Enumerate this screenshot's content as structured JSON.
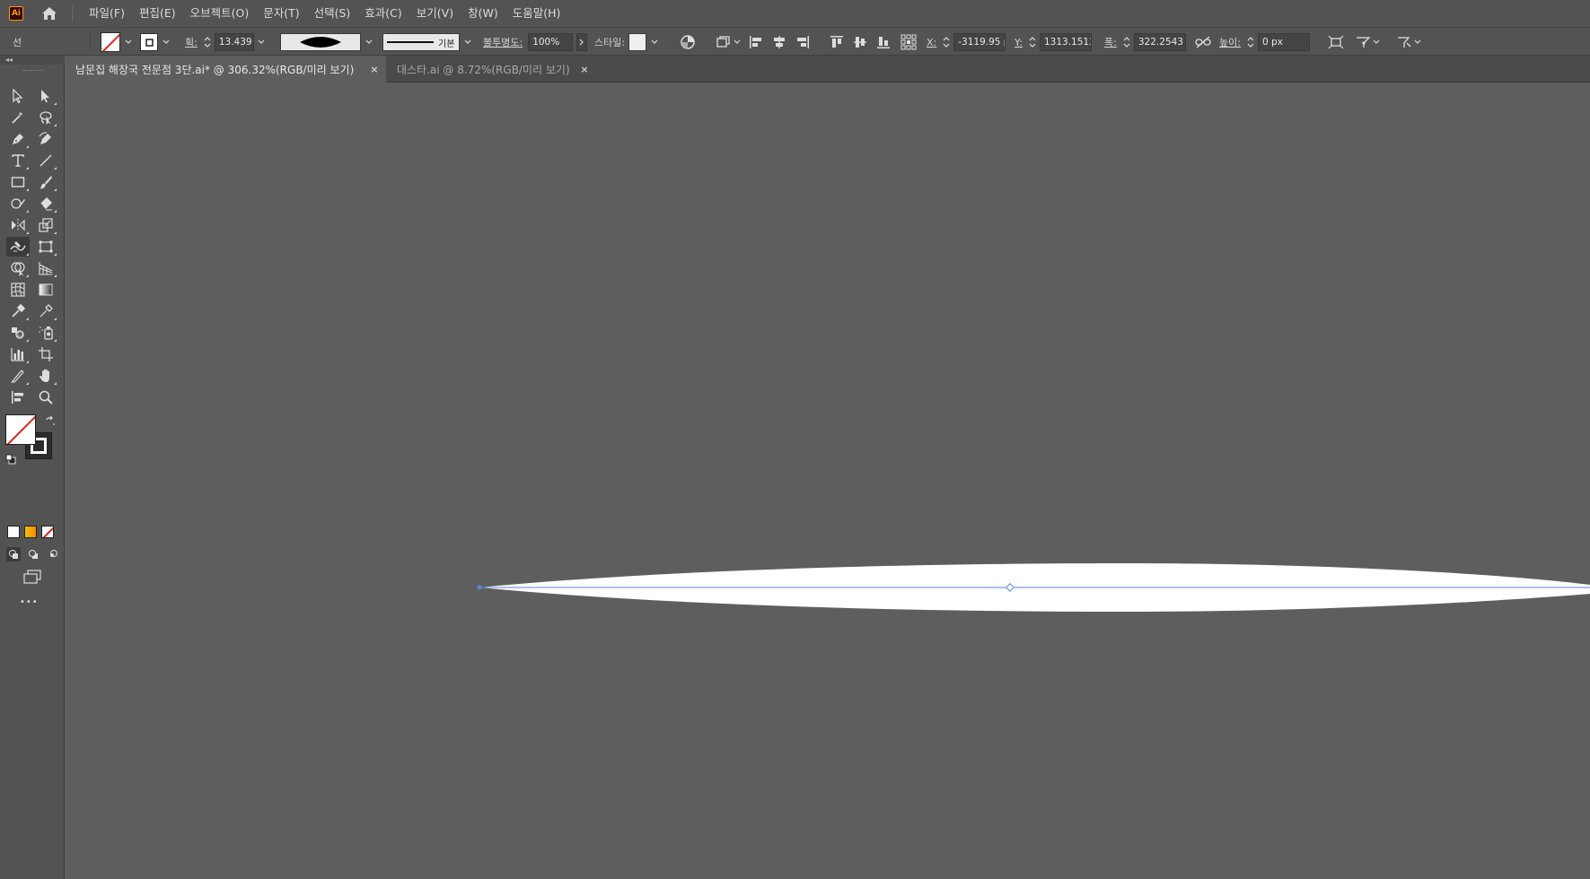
{
  "app": {
    "logo_text": "Ai",
    "accent": "#ff9a00"
  },
  "menu": [
    {
      "label": "파일(F)"
    },
    {
      "label": "편집(E)"
    },
    {
      "label": "오브젝트(O)"
    },
    {
      "label": "문자(T)"
    },
    {
      "label": "선택(S)"
    },
    {
      "label": "효과(C)"
    },
    {
      "label": "보기(V)"
    },
    {
      "label": "창(W)"
    },
    {
      "label": "도움말(H)"
    }
  ],
  "control": {
    "selection_label": "선",
    "stroke_weight_label": "획:",
    "stroke_weight_value": "13.439 p",
    "profile_label": "기본",
    "opacity_label": "불투명도:",
    "opacity_value": "100%",
    "style_label": "스타일:",
    "x_label": "X:",
    "x_value": "-3119.95 p",
    "y_label": "Y:",
    "y_value": "1313.1513",
    "width_label": "폭:",
    "width_value": "322.2543 p",
    "height_label": "높이:",
    "height_value": "0 px"
  },
  "tabs": [
    {
      "label": "남문집 해장국 전문점 3단.ai* @ 306.32%(RGB/미리 보기)",
      "active": true,
      "close": "×"
    },
    {
      "label": "대스타.ai @ 8.72%(RGB/미리 보기)",
      "active": false,
      "close": "×"
    }
  ],
  "tools": {
    "more_label": "•••"
  },
  "colors": {
    "canvas": "#5e5e5e",
    "shape_fill": "#ffffff",
    "path_stroke": "#5b86d6"
  }
}
